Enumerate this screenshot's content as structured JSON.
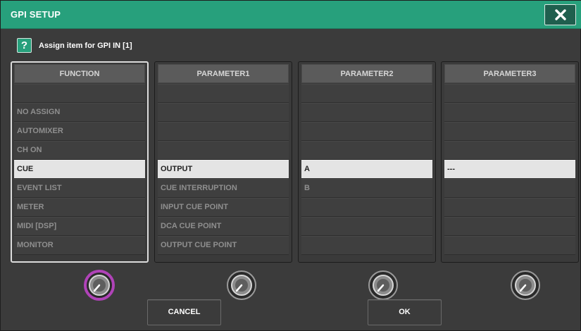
{
  "dialog": {
    "title": "GPI SETUP",
    "close_icon": "close-icon",
    "help_text": "Assign item for GPI IN [1]",
    "help_icon_glyph": "?"
  },
  "columns": [
    {
      "header": "FUNCTION",
      "items": [
        "",
        "NO ASSIGN",
        "AUTOMIXER",
        "CH ON",
        "CUE",
        "EVENT LIST",
        "METER",
        "MIDI [DSP]",
        "MONITOR"
      ],
      "active_index": 4,
      "focused": true
    },
    {
      "header": "PARAMETER1",
      "items": [
        "",
        "",
        "",
        "",
        "OUTPUT",
        "CUE INTERRUPTION",
        "INPUT CUE POINT",
        "DCA CUE POINT",
        "OUTPUT CUE POINT"
      ],
      "active_index": 4,
      "focused": false
    },
    {
      "header": "PARAMETER2",
      "items": [
        "",
        "",
        "",
        "",
        "A",
        "B",
        "",
        "",
        ""
      ],
      "active_index": 4,
      "focused": false
    },
    {
      "header": "PARAMETER3",
      "items": [
        "",
        "",
        "",
        "",
        "---",
        "",
        "",
        "",
        ""
      ],
      "active_index": 4,
      "focused": false
    }
  ],
  "buttons": {
    "cancel_label": "CANCEL",
    "ok_label": "OK"
  },
  "colors": {
    "title_bar": "#27a07c",
    "active_knob_ring": "#b043b8",
    "active_row": "#e4e4e4"
  }
}
